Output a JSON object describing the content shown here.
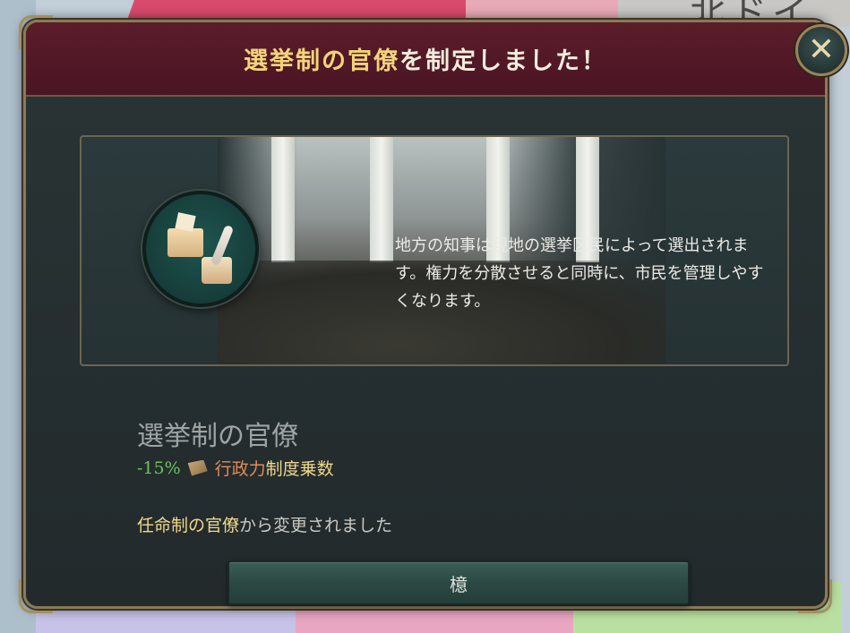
{
  "map": {
    "label": "北ドイ"
  },
  "dialog": {
    "title_highlight": "選挙制の官僚",
    "title_rest": "を制定しました！",
    "close_icon": "close-x-icon",
    "description": "地方の知事は現地の選挙区民によって選出されます。権力を分散させると同時に、市民を管理しやすくなります。",
    "law_name": "選挙制の官僚",
    "modifier": {
      "value": "-15%",
      "icon": "bureaucracy-scroll-icon",
      "name_part1": "行政力",
      "name_part2": "制度乗数"
    },
    "changed_from": {
      "law": "任命制の官僚",
      "suffix": "から変更されました"
    },
    "ok_button": "檍"
  },
  "colors": {
    "header": "#4a1523",
    "title_highlight": "#f3d47a",
    "modifier_value": "#6ec25b",
    "modifier_name1": "#e08c5a",
    "modifier_name2": "#f0d88c",
    "button": "#2c4944"
  }
}
